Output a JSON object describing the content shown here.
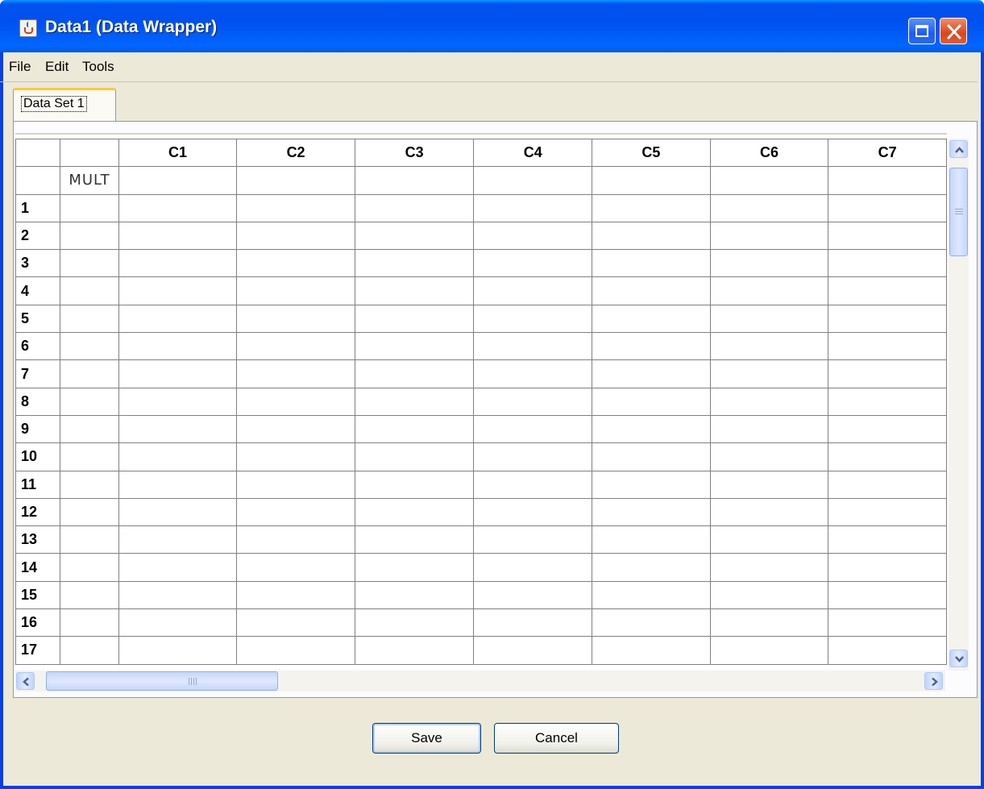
{
  "window": {
    "title": "Data1 (Data Wrapper)",
    "icon": "java-icon",
    "controls": [
      "maximize-icon",
      "close-icon"
    ]
  },
  "menu": [
    "File",
    "Edit",
    "Tools"
  ],
  "tabs": [
    {
      "label": "Data Set 1",
      "selected": true
    }
  ],
  "grid": {
    "columns": [
      "",
      "",
      "C1",
      "C2",
      "C3",
      "C4",
      "C5",
      "C6",
      "C7"
    ],
    "type_row": [
      "",
      "MULT",
      "",
      "",
      "",
      "",
      "",
      "",
      ""
    ],
    "row_labels": [
      "1",
      "2",
      "3",
      "4",
      "5",
      "6",
      "7",
      "8",
      "9",
      "10",
      "11",
      "12",
      "13",
      "14",
      "15",
      "16",
      "17"
    ]
  },
  "buttons": {
    "save": "Save",
    "cancel": "Cancel"
  }
}
